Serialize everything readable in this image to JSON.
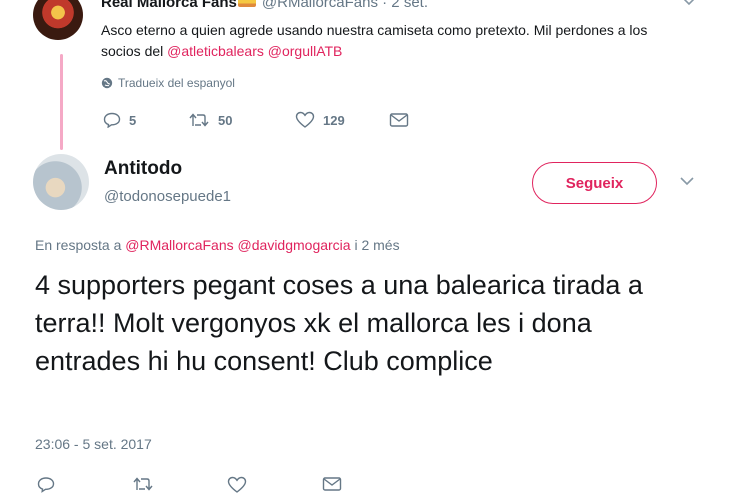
{
  "parent_tweet": {
    "name": "Real Mallorca Fans",
    "handle_and_time": "@RMallorcaFans · 2 set.",
    "text_prefix": "Asco eterno a quien agrede usando nuestra camiseta como pretexto. Mil perdones a los socios del ",
    "mention_1": "@atleticbalears",
    "mention_2": "@orgullATB",
    "translate_label": "Tradueix del espanyol",
    "reply_count": "5",
    "retweet_count": "50",
    "like_count": "129"
  },
  "main_tweet": {
    "name": "Antitodo",
    "handle": "@todonosepuede1",
    "follow_label": "Segueix",
    "reply_prefix": "En resposta a ",
    "reply_mention_1": "@RMallorcaFans",
    "reply_mention_2": "@davidgmogarcia",
    "reply_suffix": " i 2 més",
    "text": "4 supporters pegant coses a una balearica tirada a terra!! Molt vergonyos xk el mallorca les i dona entrades hi hu consent! Club complice",
    "timestamp": "23:06 - 5 set. 2017"
  },
  "colors": {
    "accent": "#e0245e",
    "secondary_text": "#657786",
    "thread_line": "#f5a9c6"
  }
}
